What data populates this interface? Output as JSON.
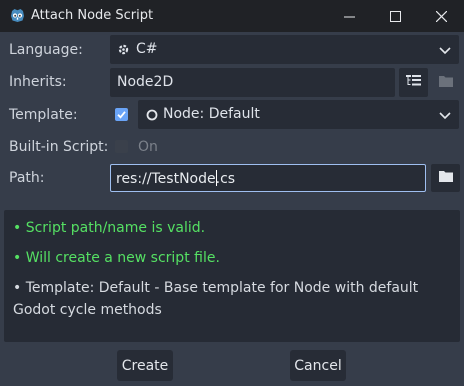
{
  "window": {
    "title": "Attach Node Script",
    "icons": [
      "godot-logo-icon",
      "minimize-icon",
      "maximize-icon",
      "close-icon"
    ]
  },
  "form": {
    "language": {
      "label": "Language:",
      "value": "C#",
      "icon": "csharp-icon"
    },
    "inherits": {
      "label": "Inherits:",
      "value": "Node2D"
    },
    "template": {
      "label": "Template:",
      "checked": true,
      "value": "Node: Default",
      "icon": "node-circle-icon"
    },
    "builtin": {
      "label": "Built-in Script:",
      "toggle_label": "On",
      "checked": false
    },
    "path": {
      "label": "Path:",
      "value_before_caret": "res://TestNode",
      "value_after_caret": ".cs"
    }
  },
  "messages": {
    "valid": "•  Script path/name is valid.",
    "create": "•  Will create a new script file.",
    "template": "•  Template: Default - Base template for Node with default Godot cycle methods"
  },
  "buttons": {
    "create": "Create",
    "cancel": "Cancel"
  },
  "colors": {
    "background": "#363d4a",
    "field": "#272c36",
    "titlebar": "#202226",
    "accent": "#6aa4f7",
    "success": "#55e063"
  }
}
